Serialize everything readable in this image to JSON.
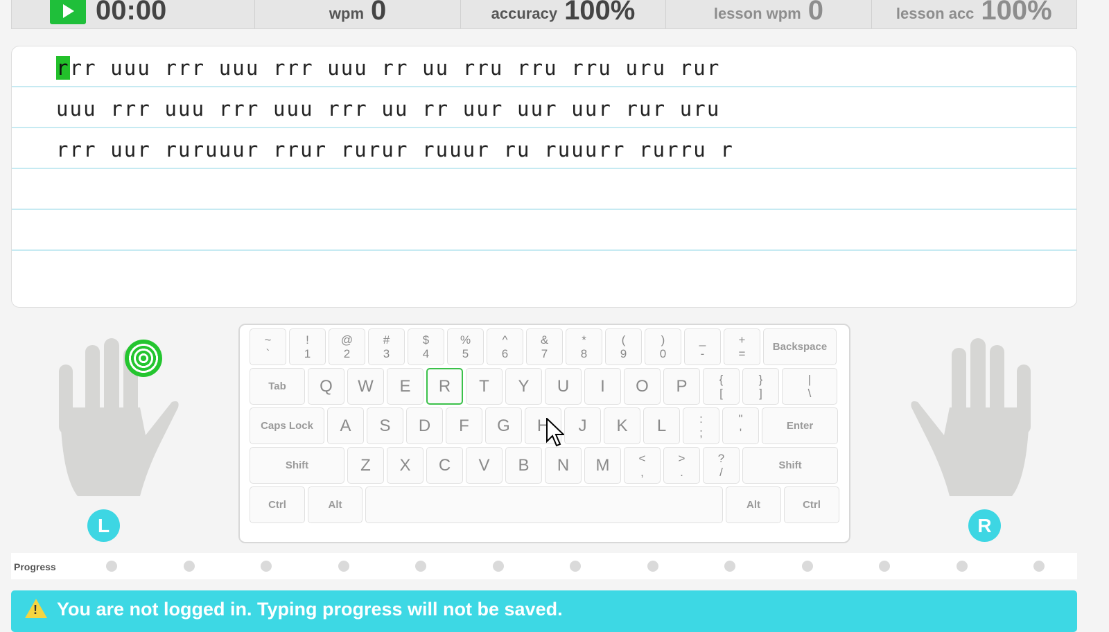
{
  "stats": {
    "timer": "00:00",
    "wpm_label": "wpm",
    "wpm_value": "0",
    "accuracy_label": "accuracy",
    "accuracy_value": "100%",
    "lesson_wpm_label": "lesson wpm",
    "lesson_wpm_value": "0",
    "lesson_acc_label": "lesson acc",
    "lesson_acc_value": "100%"
  },
  "lesson": {
    "cursor_char": "r",
    "line1_rest": "rr uuu rrr uuu rrr uuu rr uu rru rru rru uru rur",
    "line2": "uuu rrr uuu rrr uuu rrr uu rr uur uur uur rur uru",
    "line3": "rrr uur ruruuur rrur rurur ruuur ru ruuurr rurru r",
    "line4": "",
    "line5": "",
    "line6": ""
  },
  "keyboard": {
    "row1": [
      {
        "top": "~",
        "bottom": "`"
      },
      {
        "top": "!",
        "bottom": "1"
      },
      {
        "top": "@",
        "bottom": "2"
      },
      {
        "top": "#",
        "bottom": "3"
      },
      {
        "top": "$",
        "bottom": "4"
      },
      {
        "top": "%",
        "bottom": "5"
      },
      {
        "top": "^",
        "bottom": "6"
      },
      {
        "top": "&",
        "bottom": "7"
      },
      {
        "top": "*",
        "bottom": "8"
      },
      {
        "top": "(",
        "bottom": "9"
      },
      {
        "top": ")",
        "bottom": "0"
      },
      {
        "top": "_",
        "bottom": "-"
      },
      {
        "top": "+",
        "bottom": "="
      }
    ],
    "backspace": "Backspace",
    "tab": "Tab",
    "row2": [
      "Q",
      "W",
      "E",
      "R",
      "T",
      "Y",
      "U",
      "I",
      "O",
      "P"
    ],
    "row2_sym": [
      {
        "top": "{",
        "bottom": "["
      },
      {
        "top": "}",
        "bottom": "]"
      },
      {
        "top": "|",
        "bottom": "\\"
      }
    ],
    "caps": "Caps Lock",
    "row3": [
      "A",
      "S",
      "D",
      "F",
      "G",
      "H",
      "J",
      "K",
      "L"
    ],
    "row3_sym": [
      {
        "top": ":",
        "bottom": ";"
      },
      {
        "top": "\"",
        "bottom": "'"
      }
    ],
    "enter": "Enter",
    "shift": "Shift",
    "row4": [
      "Z",
      "X",
      "C",
      "V",
      "B",
      "N",
      "M"
    ],
    "row4_sym": [
      {
        "top": "<",
        "bottom": ","
      },
      {
        "top": ">",
        "bottom": "."
      },
      {
        "top": "?",
        "bottom": "/"
      }
    ],
    "ctrl": "Ctrl",
    "alt": "Alt",
    "highlight_key": "R"
  },
  "hands": {
    "left_badge": "L",
    "right_badge": "R"
  },
  "progress": {
    "label": "Progress",
    "dots": 13
  },
  "notice": {
    "text": "You are not logged in. Typing progress will not be saved."
  }
}
